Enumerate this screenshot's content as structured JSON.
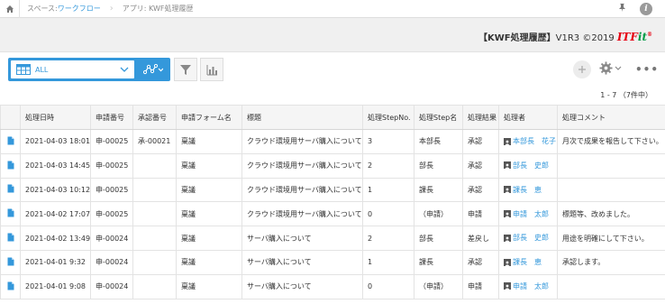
{
  "breadcrumb": {
    "space_prefix": "スペース: ",
    "space_name": "ワークフロー",
    "app": "アプリ: KWF処理履歴"
  },
  "branding": {
    "title": "【KWF処理履歴】",
    "version": "V1R3 ©2019",
    "logo_it": "IT",
    "logo_f": "F",
    "logo_it2": "it",
    "logo_mark": "®"
  },
  "toolbar": {
    "view_label": "ALL"
  },
  "pager": "1 - 7 （7件中）",
  "table": {
    "headers": [
      "",
      "処理日時",
      "申請番号",
      "承認番号",
      "申請フォーム名",
      "標題",
      "処理StepNo.",
      "処理Step名",
      "処理結果",
      "処理者",
      "処理コメント"
    ],
    "rows": [
      {
        "date": "2021-04-03 18:01",
        "app_no": "申-00025",
        "approve_no": "承-00021",
        "form": "稟議",
        "title": "クラウド環境用サーバ購入について",
        "step_no": "3",
        "step_name": "本部長",
        "result": "承認",
        "user": "本部長　花子",
        "comment": "月次で成果を報告して下さい。"
      },
      {
        "date": "2021-04-03 14:45",
        "app_no": "申-00025",
        "approve_no": "",
        "form": "稟議",
        "title": "クラウド環境用サーバ購入について",
        "step_no": "2",
        "step_name": "部長",
        "result": "承認",
        "user": "部長　史郎",
        "comment": ""
      },
      {
        "date": "2021-04-03 10:12",
        "app_no": "申-00025",
        "approve_no": "",
        "form": "稟議",
        "title": "クラウド環境用サーバ購入について",
        "step_no": "1",
        "step_name": "課長",
        "result": "承認",
        "user": "課長　恵",
        "comment": ""
      },
      {
        "date": "2021-04-02 17:07",
        "app_no": "申-00025",
        "approve_no": "",
        "form": "稟議",
        "title": "クラウド環境用サーバ購入について",
        "step_no": "0",
        "step_name": "（申請）",
        "result": "申請",
        "user": "申請　太郎",
        "comment": "標題等、改めました。"
      },
      {
        "date": "2021-04-02 13:49",
        "app_no": "申-00024",
        "approve_no": "",
        "form": "稟議",
        "title": "サーバ購入について",
        "step_no": "2",
        "step_name": "部長",
        "result": "差戻し",
        "user": "部長　史郎",
        "comment": "用途を明確にして下さい。"
      },
      {
        "date": "2021-04-01 9:32",
        "app_no": "申-00024",
        "approve_no": "",
        "form": "稟議",
        "title": "サーバ購入について",
        "step_no": "1",
        "step_name": "課長",
        "result": "承認",
        "user": "課長　恵",
        "comment": "承認します。"
      },
      {
        "date": "2021-04-01 9:08",
        "app_no": "申-00024",
        "approve_no": "",
        "form": "稟議",
        "title": "サーバ購入について",
        "step_no": "0",
        "step_name": "（申請）",
        "result": "申請",
        "user": "申請　太郎",
        "comment": ""
      }
    ]
  },
  "colors": {
    "accent": "#3498db",
    "logo_red": "#e60012",
    "logo_green": "#009a44"
  },
  "icons": {
    "home": "home-icon",
    "pin": "pin-icon",
    "info": "info-icon",
    "grid": "grid-icon",
    "graph": "graph-icon",
    "filter": "filter-icon",
    "chart": "chart-icon",
    "add": "plus-icon",
    "settings": "gear-icon",
    "more": "more-icon",
    "record": "document-icon",
    "user": "user-icon"
  }
}
